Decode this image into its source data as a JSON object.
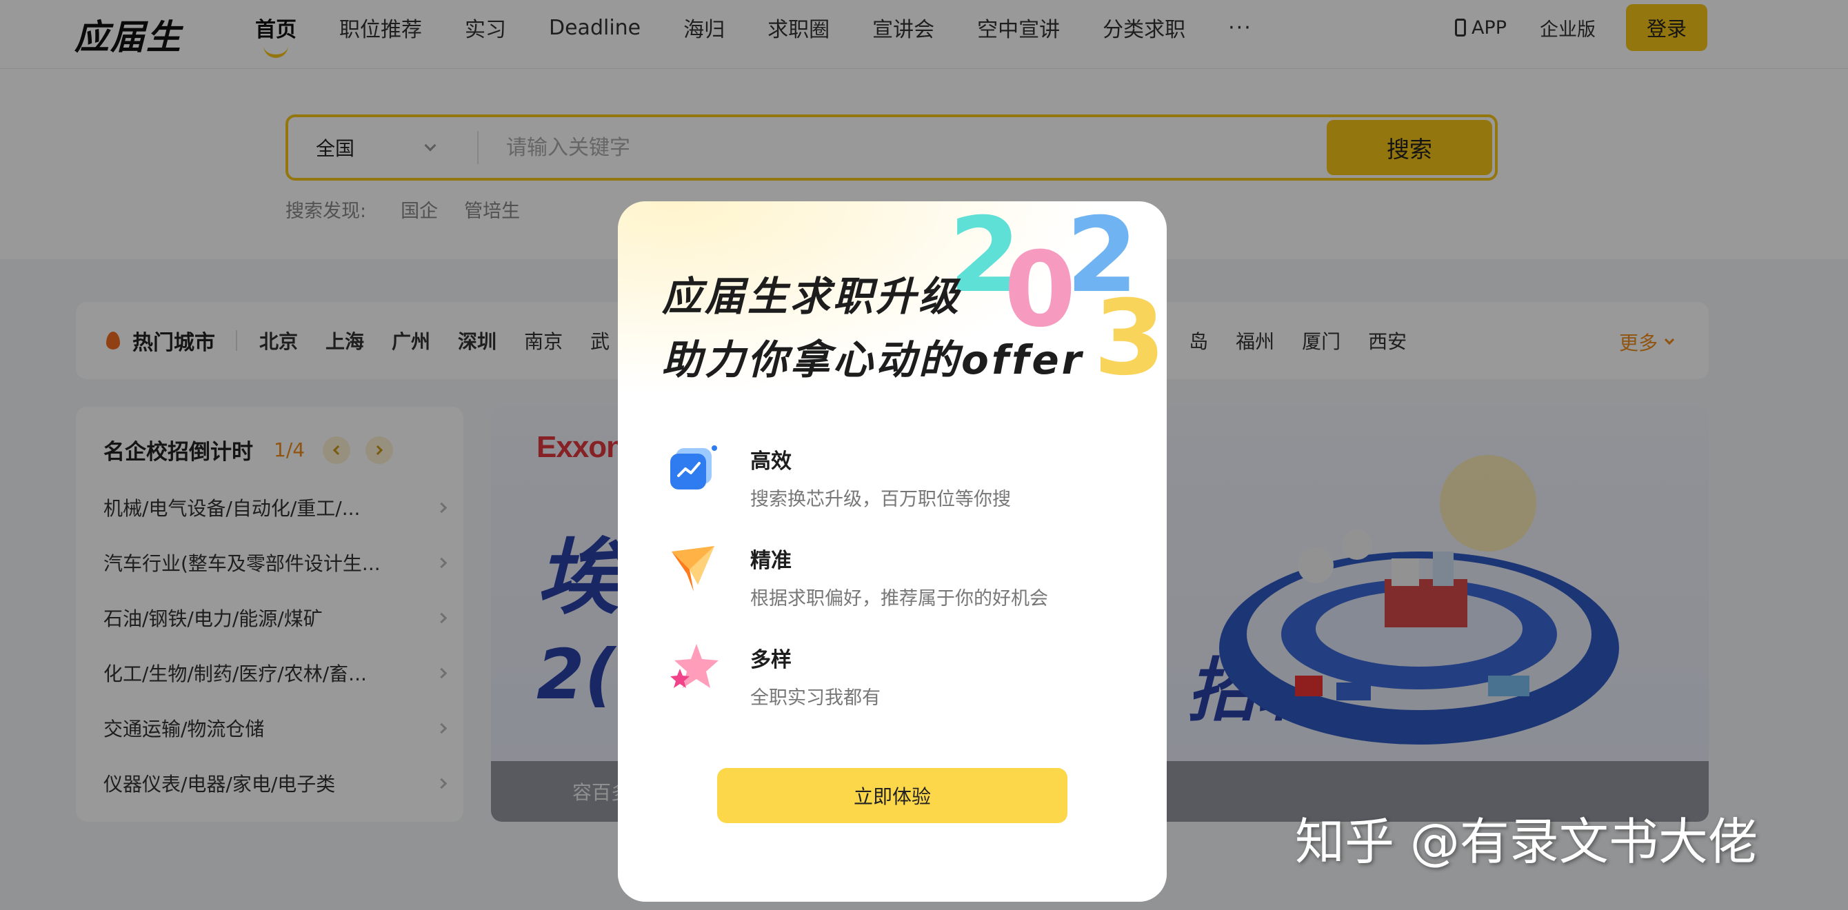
{
  "header": {
    "logo": "应届生",
    "nav": [
      "首页",
      "职位推荐",
      "实习",
      "Deadline",
      "海归",
      "求职圈",
      "宣讲会",
      "空中宣讲",
      "分类求职"
    ],
    "nav_more": "···",
    "app_label": "APP",
    "enterprise_label": "企业版",
    "login_label": "登录"
  },
  "search": {
    "city": "全国",
    "placeholder": "请输入关键字",
    "button_label": "搜索",
    "discover_label": "搜索发现:",
    "discover_tags": [
      "国企",
      "管培生"
    ]
  },
  "hot_cities": {
    "title": "热门城市",
    "bold_cities": [
      "北京",
      "上海",
      "广州",
      "深圳"
    ],
    "cities": [
      "南京",
      "武"
    ],
    "right_cities": [
      "岛",
      "福州",
      "厦门",
      "西安"
    ],
    "more_label": "更多"
  },
  "campus": {
    "title": "名企校招倒计时",
    "page": "1/4",
    "items": [
      "机械/电气设备/自动化/重工/...",
      "汽车行业(整车及零部件设计生...",
      "石油/钢铁/电力/能源/煤矿",
      "化工/生物/制药/医疗/农林/畜...",
      "交通运输/物流仓储",
      "仪器仪表/电器/家电/电子类"
    ]
  },
  "banner": {
    "logo": "Exxon",
    "big_text_1": "埃",
    "big_text_2": "2(",
    "big_text_3": "招聘",
    "caption": "容百多"
  },
  "modal": {
    "title_line1": "应届生求职升级",
    "title_line2": "助力你拿心动的offer",
    "year": [
      "2",
      "0",
      "2",
      "3"
    ],
    "features": [
      {
        "icon": "chart-card-icon",
        "name": "高效",
        "desc": "搜索换芯升级，百万职位等你搜"
      },
      {
        "icon": "paper-plane-icon",
        "name": "精准",
        "desc": "根据求职偏好，推荐属于你的好机会"
      },
      {
        "icon": "star-icon",
        "name": "多样",
        "desc": "全职实习我都有"
      }
    ],
    "cta_label": "立即体验"
  },
  "watermark": "知乎 @有录文书大佬",
  "colors": {
    "brand_yellow": "#f5c518",
    "cta_yellow": "#fdd74a",
    "accent_orange": "#f08c1a",
    "banner_blue": "#2a44a8"
  }
}
